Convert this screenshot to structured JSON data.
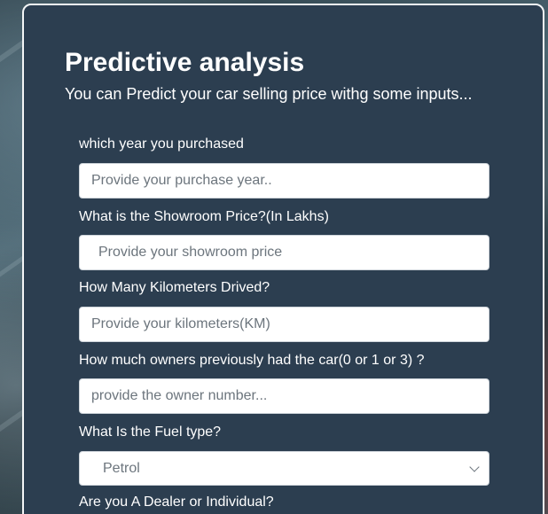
{
  "form": {
    "title": "Predictive analysis",
    "subtitle": "You can Predict your car selling price withg some inputs...",
    "fields": [
      {
        "label": "which year you purchased",
        "placeholder": "Provide your purchase year.."
      },
      {
        "label": "What is the Showroom Price?(In Lakhs)",
        "placeholder": "Provide your showroom price"
      },
      {
        "label": "How Many Kilometers Drived?",
        "placeholder": "Provide your kilometers(KM)"
      },
      {
        "label": "How much owners previously had the car(0 or 1 or 3) ?",
        "placeholder": "provide the owner number..."
      },
      {
        "label": "What Is the Fuel type?",
        "selected": "Petrol"
      },
      {
        "label": "Are you A Dealer or Individual?"
      }
    ]
  },
  "icons": {
    "dropdown": "chevron-down-icon"
  }
}
